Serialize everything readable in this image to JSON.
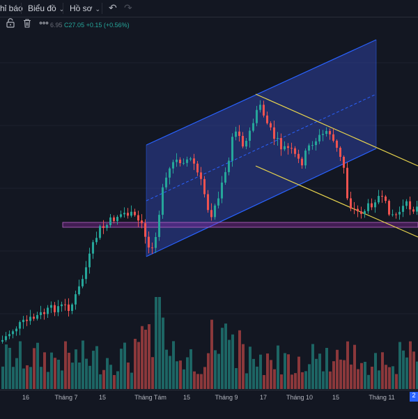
{
  "topbar": {
    "indicators_label": "hỉ báo",
    "chart_type_label": "Biểu đồ",
    "profile_label": "Hồ sơ"
  },
  "ohlc": {
    "truncated": "6.95",
    "close_label": "C27.05",
    "change": "+0.15 (+0.56%)"
  },
  "x_axis": {
    "labels": [
      "16",
      "Tháng 7",
      "15",
      "Tháng Tám",
      "15",
      "Tháng 9",
      "17",
      "Tháng 10",
      "15",
      "Tháng 11"
    ],
    "badge": "2"
  },
  "colors": {
    "up": "#26a69a",
    "down": "#ef5350",
    "background": "#131722",
    "channel_fill": "#2e3f9f",
    "channel_line": "#2962ff",
    "down_channel_line": "#e8d44d",
    "support_zone": "#9c27b0"
  },
  "icons": [
    "unlock-icon",
    "trash-icon",
    "more-icon",
    "chevron-down-icon",
    "undo-icon",
    "redo-icon"
  ]
}
